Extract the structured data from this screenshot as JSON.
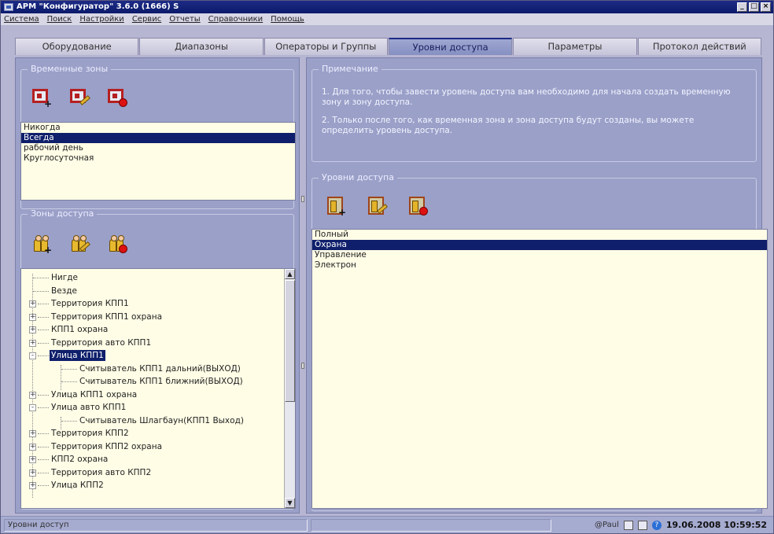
{
  "window": {
    "title": "АРМ \"Конфигуратор\" 3.6.0 (1666) S",
    "buttons": [
      "_",
      "□",
      "×"
    ]
  },
  "menu": [
    "Система",
    "Поиск",
    "Настройки",
    "Сервис",
    "Отчеты",
    "Справочники",
    "Помощь"
  ],
  "tabs": [
    {
      "label": "Оборудование",
      "active": false
    },
    {
      "label": "Диапазоны",
      "active": false
    },
    {
      "label": "Операторы и Группы",
      "active": false
    },
    {
      "label": "Уровни доступа",
      "active": true
    },
    {
      "label": "Параметры",
      "active": false
    },
    {
      "label": "Протокол действий",
      "active": false
    }
  ],
  "time_zones": {
    "title": "Временные зоны",
    "items": [
      {
        "label": "Никогда",
        "selected": false
      },
      {
        "label": "Всегда",
        "selected": true
      },
      {
        "label": "рабочий день",
        "selected": false
      },
      {
        "label": "Круглосуточная",
        "selected": false
      }
    ]
  },
  "access_zones": {
    "title": "Зоны доступа",
    "tree": [
      {
        "label": "Нигде",
        "level": 0,
        "expander": ""
      },
      {
        "label": "Везде",
        "level": 0,
        "expander": ""
      },
      {
        "label": "Территория КПП1",
        "level": 0,
        "expander": "+"
      },
      {
        "label": "Территория КПП1 охрана",
        "level": 0,
        "expander": "+"
      },
      {
        "label": "КПП1 охрана",
        "level": 0,
        "expander": "+"
      },
      {
        "label": "Территория авто КПП1",
        "level": 0,
        "expander": "+"
      },
      {
        "label": "Улица КПП1",
        "level": 0,
        "expander": "-",
        "selected": true
      },
      {
        "label": "Считыватель КПП1 дальний(ВЫХОД)",
        "level": 1,
        "expander": ""
      },
      {
        "label": "Считыватель КПП1 ближний(ВЫХОД)",
        "level": 1,
        "expander": ""
      },
      {
        "label": "Улица КПП1 охрана",
        "level": 0,
        "expander": "+"
      },
      {
        "label": "Улица авто КПП1",
        "level": 0,
        "expander": "-"
      },
      {
        "label": "Считыватель Шлагбаун(КПП1 Выход)",
        "level": 1,
        "expander": ""
      },
      {
        "label": "Территория КПП2",
        "level": 0,
        "expander": "+"
      },
      {
        "label": "Территория КПП2 охрана",
        "level": 0,
        "expander": "+"
      },
      {
        "label": "КПП2 охрана",
        "level": 0,
        "expander": "+"
      },
      {
        "label": "Территория авто КПП2",
        "level": 0,
        "expander": "+"
      },
      {
        "label": "Улица КПП2",
        "level": 0,
        "expander": "+"
      }
    ]
  },
  "note": {
    "title": "Примечание",
    "line1": "1. Для того, чтобы завести уровень доступа вам необходимо для начала создать временную зону и зону доступа.",
    "line2": "2. Только после того, как временная зона и зона доступа будут созданы, вы можете определить уровень доступа."
  },
  "access_levels": {
    "title": "Уровни доступа",
    "items": [
      {
        "label": "Полный",
        "selected": false
      },
      {
        "label": "Охрана",
        "selected": true
      },
      {
        "label": "Управление",
        "selected": false
      },
      {
        "label": "Электрон",
        "selected": false
      }
    ]
  },
  "status": {
    "text": "Уровни доступ",
    "user": "@Paul",
    "datetime": "19.06.2008 10:59:52"
  }
}
